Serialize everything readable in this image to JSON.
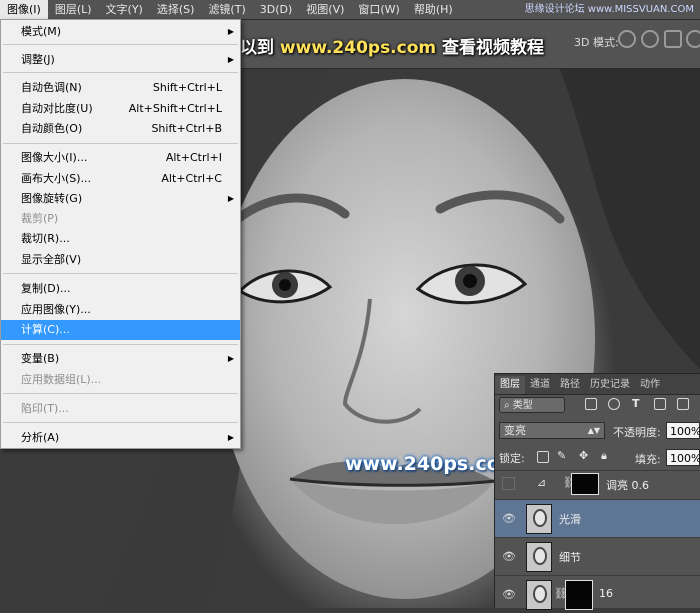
{
  "menubar": {
    "items": [
      "图像(I)",
      "图层(L)",
      "文字(Y)",
      "选择(S)",
      "滤镜(T)",
      "3D(D)",
      "视图(V)",
      "窗口(W)",
      "帮助(H)"
    ],
    "watermark": "思缘设计论坛 www.MISSVUAN.COM"
  },
  "optionsbar": {
    "mode_label": "3D 模式:"
  },
  "banner": {
    "prefix": "如有疑问可以到",
    "url": "www.240ps.com",
    "suffix": "查看视频教程"
  },
  "site_mark": "www.240ps.com",
  "image_menu": {
    "mode": "模式(M)",
    "adjustments": "调整(J)",
    "auto_tone": {
      "label": "自动色调(N)",
      "shortcut": "Shift+Ctrl+L"
    },
    "auto_contrast": {
      "label": "自动对比度(U)",
      "shortcut": "Alt+Shift+Ctrl+L"
    },
    "auto_color": {
      "label": "自动颜色(O)",
      "shortcut": "Shift+Ctrl+B"
    },
    "image_size": {
      "label": "图像大小(I)...",
      "shortcut": "Alt+Ctrl+I"
    },
    "canvas_size": {
      "label": "画布大小(S)...",
      "shortcut": "Alt+Ctrl+C"
    },
    "image_rotation": "图像旋转(G)",
    "crop": "裁剪(P)",
    "trim": "裁切(R)...",
    "reveal_all": "显示全部(V)",
    "duplicate": "复制(D)...",
    "apply_image": "应用图像(Y)...",
    "calculations": "计算(C)...",
    "variables": "变量(B)",
    "apply_data_set": "应用数据组(L)...",
    "trap": "陷印(T)...",
    "analysis": "分析(A)"
  },
  "layers_panel": {
    "tabs": [
      "图层",
      "通道",
      "路径",
      "历史记录",
      "动作"
    ],
    "filter_kind": "类型",
    "blend_mode": "变亮",
    "opacity_label": "不透明度:",
    "opacity_value": "100%",
    "lock_label": "锁定:",
    "fill_label": "填充:",
    "fill_value": "100%",
    "layers": [
      {
        "name": "调亮 0.6",
        "visible": false,
        "selected": false
      },
      {
        "name": "光滑",
        "visible": true,
        "selected": true
      },
      {
        "name": "细节",
        "visible": true,
        "selected": false
      },
      {
        "name": "16",
        "visible": true,
        "selected": false
      }
    ]
  },
  "colors": {
    "menu_highlight": "#3399ff",
    "selected_layer": "#5f7594",
    "banner_url": "#ffe25a"
  }
}
